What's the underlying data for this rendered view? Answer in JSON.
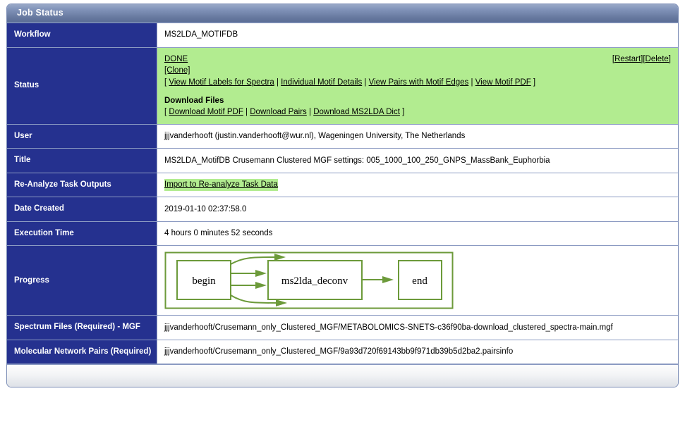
{
  "panel": {
    "title": "Job Status"
  },
  "colors": {
    "header_blue": "#67799f",
    "label_navy": "#25318f",
    "status_green": "#b2ec90",
    "diagram_green": "#6c9a3a"
  },
  "rows": {
    "workflow": {
      "label": "Workflow",
      "value": "MS2LDA_MOTIFDB"
    },
    "status": {
      "label": "Status",
      "state": "DONE",
      "clone": "[Clone]",
      "restart": "[Restart]",
      "delete": "[Delete]",
      "bracket_open": "[ ",
      "bracket_close": " ]",
      "sep": " | ",
      "links": [
        "View Motif Labels for Spectra",
        "Individual Motif Details",
        "View Pairs with Motif Edges",
        "View Motif PDF"
      ],
      "download_heading": "Download Files",
      "download_links": [
        "Download Motif PDF",
        "Download Pairs",
        "Download MS2LDA Dict"
      ]
    },
    "user": {
      "label": "User",
      "value": "jjjvanderhooft (justin.vanderhooft@wur.nl), Wageningen University, The Netherlands"
    },
    "title": {
      "label": "Title",
      "value": "MS2LDA_MotifDB Crusemann Clustered MGF settings: 005_1000_100_250_GNPS_MassBank_Euphorbia"
    },
    "reanalyze": {
      "label": "Re-Analyze Task Outputs",
      "link": "Import to Re-analyze Task Data"
    },
    "date_created": {
      "label": "Date Created",
      "value": "2019-01-10 02:37:58.0"
    },
    "execution_time": {
      "label": "Execution Time",
      "value": "4 hours 0 minutes 52 seconds"
    },
    "progress": {
      "label": "Progress",
      "nodes": {
        "begin": "begin",
        "middle": "ms2lda_deconv",
        "end": "end"
      }
    },
    "spectrum_files": {
      "label": "Spectrum Files (Required) - MGF",
      "value": "jjjvanderhooft/Crusemann_only_Clustered_MGF/METABOLOMICS-SNETS-c36f90ba-download_clustered_spectra-main.mgf"
    },
    "network_pairs": {
      "label": "Molecular Network Pairs (Required)",
      "value": "jjjvanderhooft/Crusemann_only_Clustered_MGF/9a93d720f69143bb9f971db39b5d2ba2.pairsinfo"
    }
  }
}
